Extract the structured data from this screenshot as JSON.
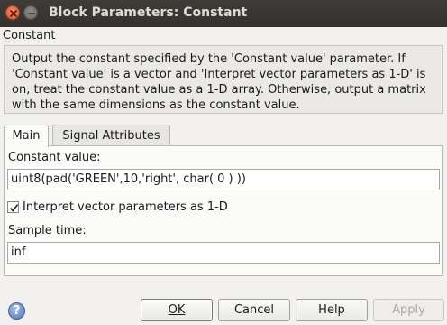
{
  "window": {
    "title": "Block Parameters: Constant"
  },
  "block": {
    "type": "Constant",
    "description_lines": [
      "Output the constant specified by the 'Constant value' parameter. If",
      "'Constant value' is a vector and 'Interpret vector parameters as 1-D' is",
      "on, treat the constant value as a 1-D array. Otherwise, output a matrix",
      "with the same dimensions as the constant value."
    ]
  },
  "tabs": [
    {
      "label": "Main",
      "active": true
    },
    {
      "label": "Signal Attributes",
      "active": false
    }
  ],
  "main": {
    "constant_value_label": "Constant value:",
    "constant_value": "uint8(pad('GREEN',10,'right', char( 0 ) ))",
    "interpret_label": "Interpret vector parameters as 1-D",
    "interpret_checked": true,
    "sample_time_label": "Sample time:",
    "sample_time": "inf"
  },
  "buttons": {
    "help_icon": "?",
    "ok": "OK",
    "cancel": "Cancel",
    "help": "Help",
    "apply": "Apply"
  },
  "icons": [
    "close-icon",
    "minimize-icon",
    "checkmark-icon",
    "help-icon"
  ],
  "colors": {
    "titlebar": "#3d3c38",
    "close_button": "#e4522a",
    "dialog_background": "#f2f1f0"
  }
}
